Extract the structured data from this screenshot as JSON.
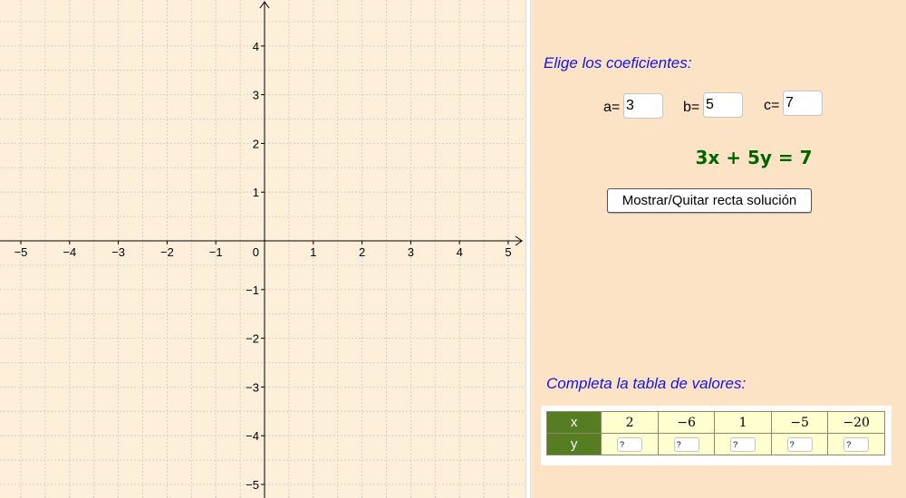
{
  "graph": {
    "x_range": [
      -5.4,
      5.4
    ],
    "y_range": [
      -5.2,
      4.9
    ],
    "x_ticks": [
      -5,
      -4,
      -3,
      -2,
      -1,
      1,
      2,
      3,
      4,
      5
    ],
    "y_ticks": [
      4,
      3,
      2,
      1,
      -1,
      -2,
      -3,
      -4,
      -5
    ],
    "x_tick_labels": [
      "−5",
      "−4",
      "−3",
      "−2",
      "−1",
      "1",
      "2",
      "3",
      "4",
      "5"
    ],
    "y_tick_labels": [
      "4",
      "3",
      "2",
      "1",
      "−1",
      "−2",
      "−3",
      "−4",
      "−5"
    ],
    "origin_label": "0",
    "grid": true,
    "colors": {
      "background": "#fdefd9",
      "grid": "#c8c8c8",
      "axis": "#000000"
    }
  },
  "coefficients": {
    "heading": "Elige los coeficientes:",
    "a_label": "a=",
    "a_value": "3",
    "b_label": "b=",
    "b_value": "5",
    "c_label": "c=",
    "c_value": "7"
  },
  "equation": "3x + 5y = 7",
  "toggle_button_label": "Mostrar/Quitar recta solución",
  "table": {
    "heading": "Completa la tabla de valores:",
    "x_header": "x",
    "y_header": "y",
    "x_values": [
      "2",
      "−6",
      "1",
      "−5",
      "−20"
    ],
    "y_values": [
      "?",
      "?",
      "?",
      "?",
      "?"
    ]
  },
  "colors": {
    "heading": "#1414e6",
    "equation": "#006400",
    "table_header_bg": "#577d23",
    "table_cell_bg": "#ffffd0",
    "panel_bg": "#fde3c6"
  }
}
